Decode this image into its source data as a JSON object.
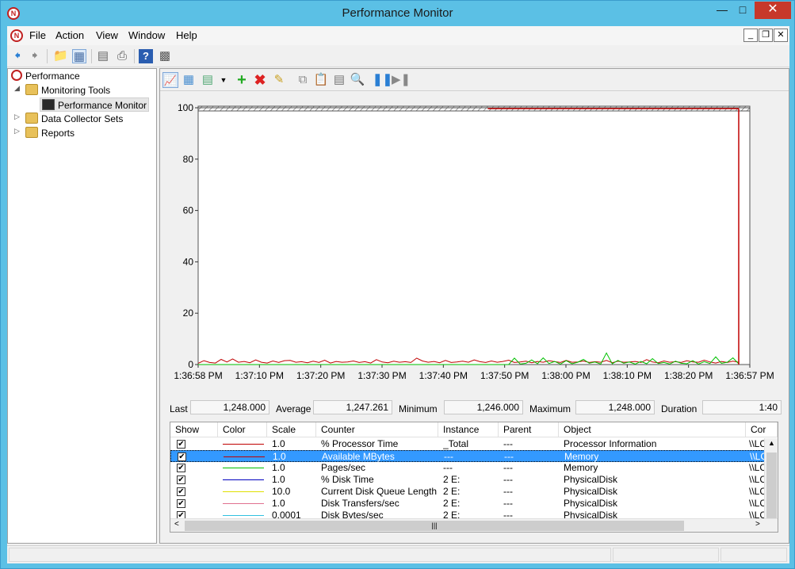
{
  "window": {
    "title": "Performance Monitor"
  },
  "menu": [
    "File",
    "Action",
    "View",
    "Window",
    "Help"
  ],
  "tree": {
    "root": "Performance",
    "monitoring_tools": "Monitoring Tools",
    "performance_monitor": "Performance Monitor",
    "data_collector_sets": "Data Collector Sets",
    "reports": "Reports"
  },
  "chart_data": {
    "type": "line",
    "title": "",
    "xlabel": "",
    "ylabel": "",
    "ylim": [
      0,
      100
    ],
    "yticks": [
      0,
      20,
      40,
      60,
      80,
      100
    ],
    "xticks": [
      "1:36:58 PM",
      "1:37:10 PM",
      "1:37:20 PM",
      "1:37:30 PM",
      "1:37:40 PM",
      "1:37:50 PM",
      "1:38:00 PM",
      "1:38:10 PM",
      "1:38:20 PM",
      "1:36:57 PM"
    ],
    "grid": false,
    "series": [
      {
        "name": "% Processor Time",
        "color": "#c00000",
        "values": [
          0.5,
          1.5,
          0.8,
          0.6,
          2.0,
          1.0,
          2.2,
          0.9,
          1.2,
          0.7,
          1.8,
          0.9,
          0.6,
          1.4,
          0.8,
          1.5,
          1.6,
          0.9,
          1.1,
          0.7,
          1.3,
          0.8,
          1.7,
          0.6,
          1.2,
          0.9,
          1.0,
          1.4,
          0.8,
          1.1,
          0.6,
          1.9,
          1.0,
          0.7,
          1.3,
          0.9,
          1.1,
          0.8,
          2.5,
          1.4,
          0.9,
          1.2,
          0.7,
          1.6,
          0.8,
          1.0,
          1.3,
          0.9,
          1.8,
          1.1,
          0.8,
          1.4,
          0.9,
          1.2,
          1.7,
          0.8,
          1.0,
          1.3,
          0.7,
          1.2,
          0.9,
          1.5,
          1.1,
          0.8,
          1.6,
          0.9,
          1.0,
          1.4,
          0.8,
          1.1,
          0.9,
          1.6,
          0.7,
          1.3,
          0.9,
          1.0,
          1.2,
          0.8,
          1.9,
          1.0,
          0.7,
          1.4,
          0.9,
          1.1,
          0.8,
          1.5,
          1.0,
          0.9,
          1.7,
          1.0,
          0.6,
          1.2,
          0.8,
          1.3,
          0.9
        ]
      },
      {
        "name": "Available MBytes",
        "color": "#c00000",
        "values": []
      },
      {
        "name": "Pages/sec",
        "color": "#00c000",
        "values": [
          0,
          0,
          0,
          0,
          0,
          0,
          0,
          0,
          0,
          0,
          0,
          0,
          0,
          0,
          0,
          0,
          0,
          0,
          0,
          0,
          0,
          0,
          0,
          0,
          0,
          0,
          0,
          0,
          0,
          0,
          0,
          0,
          0,
          0,
          0,
          0,
          0,
          0,
          0,
          0,
          0,
          0,
          0,
          0,
          0,
          0,
          0,
          0,
          0,
          0,
          0,
          0,
          0,
          0,
          0,
          2.5,
          0.2,
          0.5,
          1.8,
          0.3,
          2.6,
          0.4,
          1.2,
          0.2,
          1.5,
          0.3,
          0.9,
          2.0,
          0.5,
          1.0,
          0.2,
          4.5,
          0.3,
          1.6,
          0.5,
          1.0,
          0.2,
          1.2,
          0.3,
          2.3,
          0.4,
          0.8,
          0.2,
          1.3,
          0.5,
          0.3,
          1.5,
          0.2,
          1.1,
          0.4,
          3.0,
          0.5,
          0.9,
          2.6,
          0.3
        ]
      }
    ]
  },
  "stats": {
    "last_label": "Last",
    "last_value": "1,248.000",
    "avg_label": "Average",
    "avg_value": "1,247.261",
    "min_label": "Minimum",
    "min_value": "1,246.000",
    "max_label": "Maximum",
    "max_value": "1,248.000",
    "duration_label": "Duration",
    "duration_value": "1:40"
  },
  "grid": {
    "headers": [
      "Show",
      "Color",
      "Scale",
      "Counter",
      "Instance",
      "Parent",
      "Object",
      "Cor"
    ],
    "rows": [
      {
        "color": "#c00000",
        "scale": "1.0",
        "counter": "% Processor Time",
        "instance": "_Total",
        "parent": "---",
        "object": "Processor Information",
        "computer": "\\\\LC"
      },
      {
        "color": "#c00000",
        "scale": "1.0",
        "counter": "Available MBytes",
        "instance": "---",
        "parent": "---",
        "object": "Memory",
        "computer": "\\\\LC"
      },
      {
        "color": "#00c000",
        "scale": "1.0",
        "counter": "Pages/sec",
        "instance": "---",
        "parent": "---",
        "object": "Memory",
        "computer": "\\\\LC"
      },
      {
        "color": "#0000c0",
        "scale": "1.0",
        "counter": "% Disk Time",
        "instance": "2 E:",
        "parent": "---",
        "object": "PhysicalDisk",
        "computer": "\\\\LC"
      },
      {
        "color": "#e0e000",
        "scale": "10.0",
        "counter": "Current Disk Queue Length",
        "instance": "2 E:",
        "parent": "---",
        "object": "PhysicalDisk",
        "computer": "\\\\LC"
      },
      {
        "color": "#e07090",
        "scale": "1.0",
        "counter": "Disk Transfers/sec",
        "instance": "2 E:",
        "parent": "---",
        "object": "PhysicalDisk",
        "computer": "\\\\LC"
      },
      {
        "color": "#30c0e0",
        "scale": "0.0001",
        "counter": "Disk Bytes/sec",
        "instance": "2 E:",
        "parent": "---",
        "object": "PhysicalDisk",
        "computer": "\\\\LC"
      }
    ]
  }
}
